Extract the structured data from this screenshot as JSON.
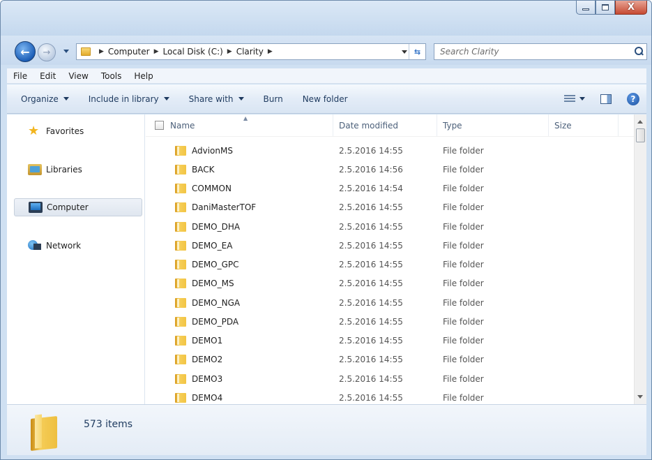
{
  "window": {
    "accent": "#1d5fb8",
    "close_color": "#c64a32"
  },
  "caption": {
    "close_glyph": "X"
  },
  "address": {
    "crumbs": [
      "Computer",
      "Local Disk (C:)",
      "Clarity"
    ],
    "separator": "▶"
  },
  "search": {
    "placeholder": "Search Clarity"
  },
  "menu": {
    "items": [
      "File",
      "Edit",
      "View",
      "Tools",
      "Help"
    ]
  },
  "commands": {
    "organize": "Organize",
    "include": "Include in library",
    "share": "Share with",
    "burn": "Burn",
    "new_folder": "New folder",
    "help_glyph": "?"
  },
  "nav": {
    "favorites": "Favorites",
    "libraries": "Libraries",
    "computer": "Computer",
    "network": "Network",
    "selected": "Computer"
  },
  "columns": {
    "name": "Name",
    "date": "Date modified",
    "type": "Type",
    "size": "Size"
  },
  "files": [
    {
      "name": "AdvionMS",
      "date": "2.5.2016 14:55",
      "type": "File folder"
    },
    {
      "name": "BACK",
      "date": "2.5.2016 14:56",
      "type": "File folder"
    },
    {
      "name": "COMMON",
      "date": "2.5.2016 14:54",
      "type": "File folder"
    },
    {
      "name": "DaniMasterTOF",
      "date": "2.5.2016 14:55",
      "type": "File folder"
    },
    {
      "name": "DEMO_DHA",
      "date": "2.5.2016 14:55",
      "type": "File folder"
    },
    {
      "name": "DEMO_EA",
      "date": "2.5.2016 14:55",
      "type": "File folder"
    },
    {
      "name": "DEMO_GPC",
      "date": "2.5.2016 14:55",
      "type": "File folder"
    },
    {
      "name": "DEMO_MS",
      "date": "2.5.2016 14:55",
      "type": "File folder"
    },
    {
      "name": "DEMO_NGA",
      "date": "2.5.2016 14:55",
      "type": "File folder"
    },
    {
      "name": "DEMO_PDA",
      "date": "2.5.2016 14:55",
      "type": "File folder"
    },
    {
      "name": "DEMO1",
      "date": "2.5.2016 14:55",
      "type": "File folder"
    },
    {
      "name": "DEMO2",
      "date": "2.5.2016 14:55",
      "type": "File folder"
    },
    {
      "name": "DEMO3",
      "date": "2.5.2016 14:55",
      "type": "File folder"
    },
    {
      "name": "DEMO4",
      "date": "2.5.2016 14:55",
      "type": "File folder"
    }
  ],
  "status": {
    "count": "573 items"
  }
}
